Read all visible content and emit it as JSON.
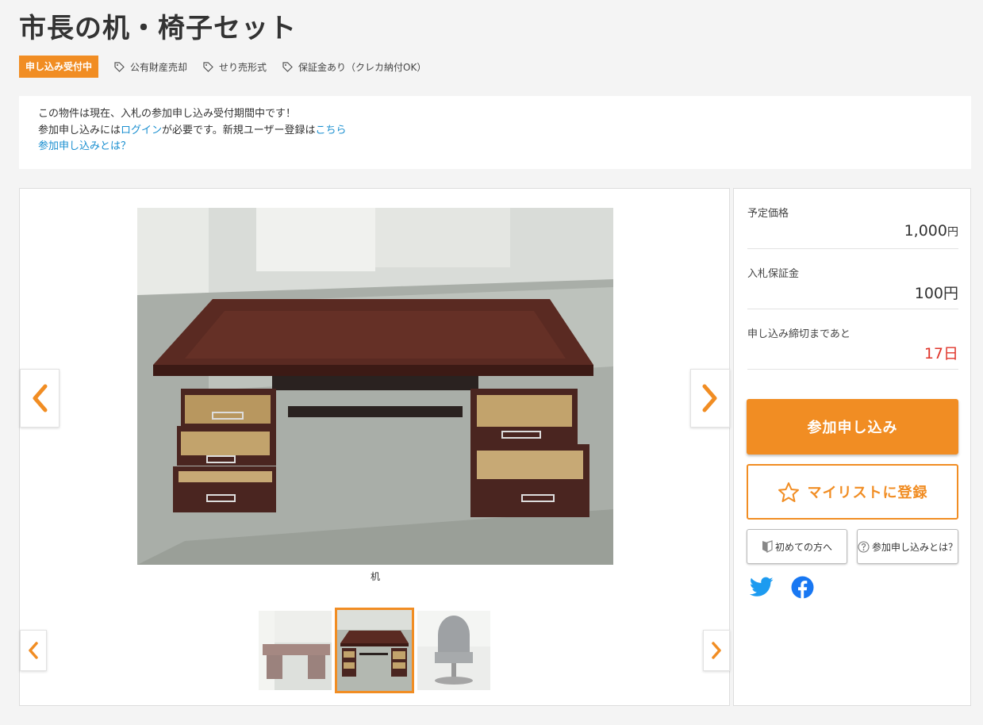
{
  "title": "市長の机・椅子セット",
  "status_badge": "申し込み受付中",
  "tags": [
    "公有財産売却",
    "せり売形式",
    "保証金あり（クレカ納付OK）"
  ],
  "notice": {
    "line1": "この物件は現在、入札の参加申し込み受付期間中です！",
    "line2_prefix": "参加申し込みには",
    "login_link": "ログイン",
    "line2_middle": "が必要です。新規ユーザー登録は",
    "register_link": "こちら",
    "what_link": "参加申し込みとは？"
  },
  "gallery": {
    "caption": "机",
    "thumbnails": [
      "desk-front",
      "desk-drawers-open",
      "chair"
    ],
    "selected_thumbnail": 1
  },
  "side": {
    "price_label": "予定価格",
    "price_value": "1,000",
    "price_unit": "円",
    "deposit_label": "入札保証金",
    "deposit_value": "100円",
    "deadline_label": "申し込み締切まであと",
    "deadline_value": "17日",
    "apply_button": "参加申し込み",
    "mylist_button": "マイリストに登録",
    "beginner_button": "初めての方へ",
    "what_button": "参加申し込みとは？"
  },
  "colors": {
    "accent": "#f18d23",
    "link": "#1a8fd0",
    "deadline": "#e0352b",
    "twitter": "#1d9bf0",
    "facebook": "#1877f2"
  },
  "icons": [
    "tag-icon",
    "chevron-left-icon",
    "chevron-right-icon",
    "star-icon",
    "beginner-mark-icon",
    "question-icon",
    "twitter-icon",
    "facebook-icon"
  ]
}
